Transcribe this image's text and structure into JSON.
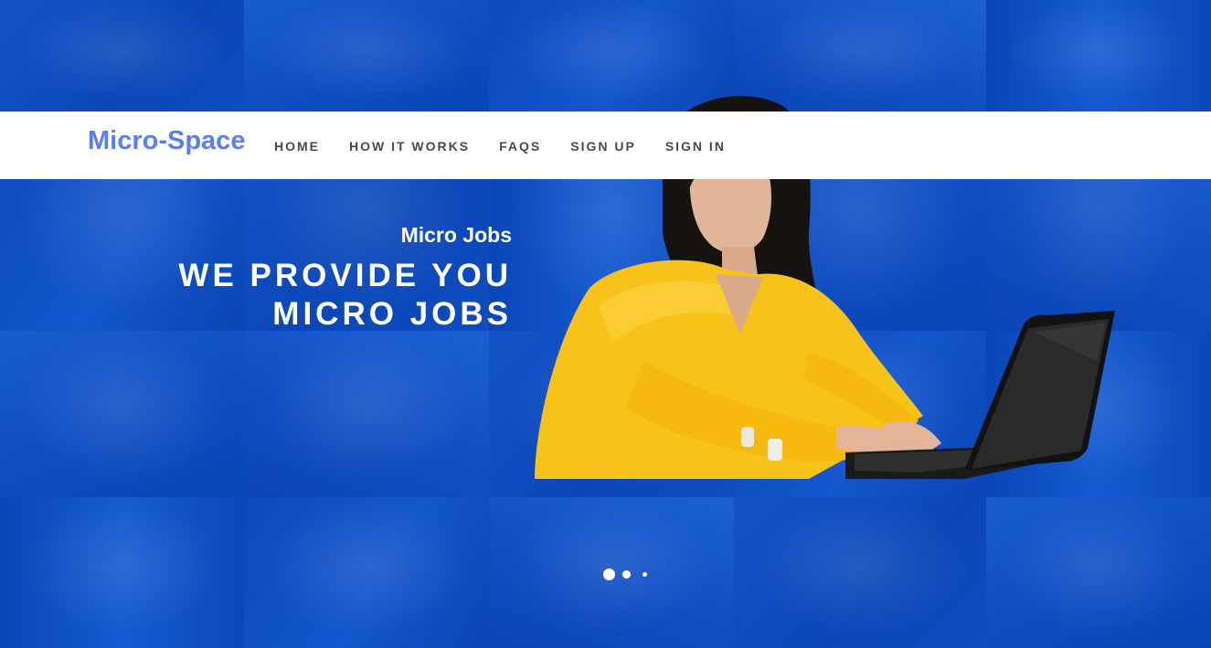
{
  "brand": {
    "logo_text": "Micro-Space",
    "logo_color": "#5b7ff0",
    "accent": "#0a4fc7"
  },
  "nav": {
    "items": [
      {
        "label": "HOME"
      },
      {
        "label": "HOW IT WORKS"
      },
      {
        "label": "FAQS"
      },
      {
        "label": "SIGN UP"
      },
      {
        "label": "SIGN IN"
      }
    ]
  },
  "hero": {
    "kicker": "Micro Jobs",
    "headline_line1": "WE PROVIDE YOU",
    "headline_line2": "MICRO JOBS",
    "image_subject": "woman-with-laptop"
  },
  "carousel": {
    "slide_count": 3,
    "active_index": 0
  }
}
